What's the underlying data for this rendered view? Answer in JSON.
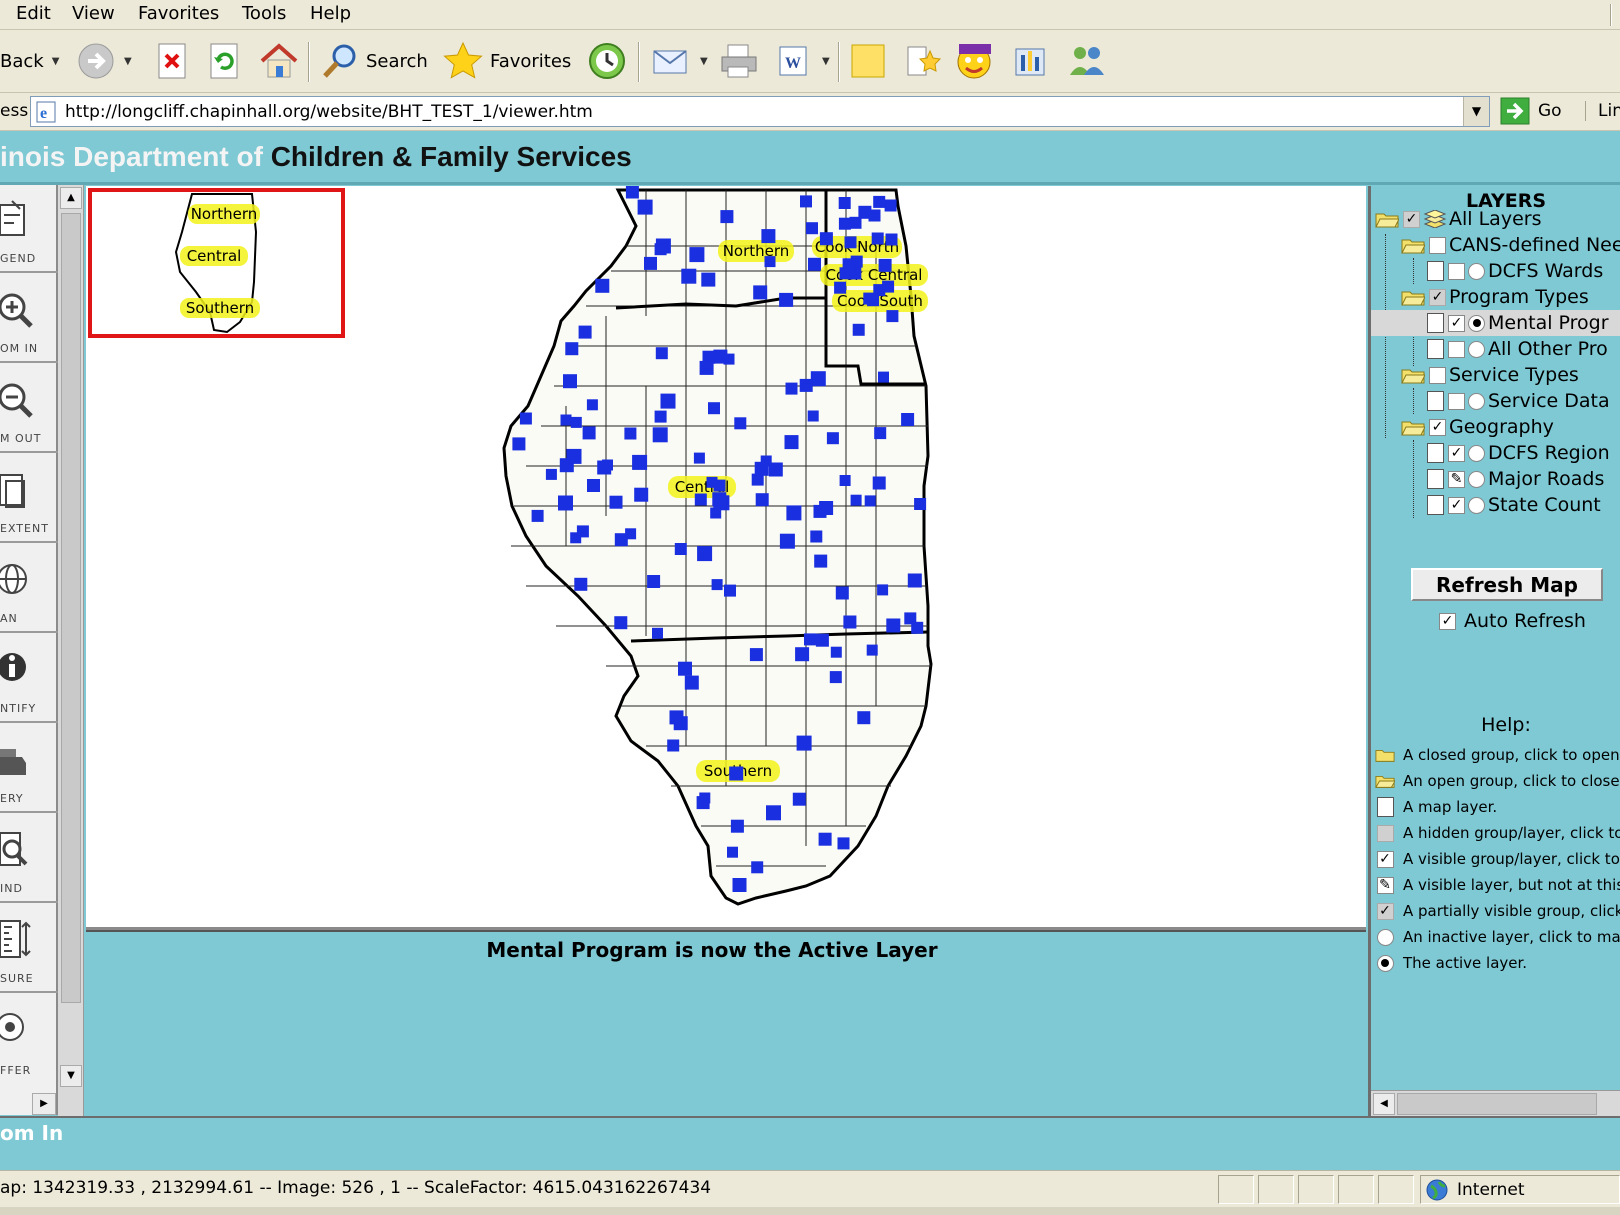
{
  "menu": [
    "Edit",
    "View",
    "Favorites",
    "Tools",
    "Help"
  ],
  "toolbar": {
    "back_label": "Back",
    "search_label": "Search",
    "favorites_label": "Favorites"
  },
  "address": {
    "label": "ess",
    "url": "http://longcliff.chapinhall.org/website/BHT_TEST_1/viewer.htm",
    "go_label": "Go",
    "links_label": "Lin"
  },
  "header": {
    "title_part1": "inois Department of",
    "title_part2": "Children & Family Services"
  },
  "tools": [
    {
      "name": "legend",
      "label": "GEND"
    },
    {
      "name": "zoom-in",
      "label": "OM IN"
    },
    {
      "name": "zoom-out",
      "label": "M OUT"
    },
    {
      "name": "full-extent",
      "label": "EXTENT"
    },
    {
      "name": "pan",
      "label": "AN"
    },
    {
      "name": "identify",
      "label": "NTIFY"
    },
    {
      "name": "query",
      "label": "ERY"
    },
    {
      "name": "find",
      "label": "IND"
    },
    {
      "name": "measure",
      "label": "SURE"
    },
    {
      "name": "buffer",
      "label": "FFER"
    }
  ],
  "overview": {
    "labels": [
      "Northern",
      "Central",
      "Southern"
    ]
  },
  "map": {
    "region_labels": [
      "Northern",
      "Cook North",
      "Cook Central",
      "Cook South",
      "Central",
      "Southern"
    ],
    "marker_color": "#1a2fe0",
    "label_highlight": "#f2f21a",
    "program_site_count": 130
  },
  "message": "Mental Program is now the Active Layer",
  "layers": {
    "title": "LAYERS",
    "items": [
      {
        "label": "All Layers",
        "kind": "group",
        "state": "partial"
      },
      {
        "label": "CANS-defined Nee",
        "kind": "group",
        "state": "hidden"
      },
      {
        "label": "DCFS Wards",
        "kind": "layer",
        "state": "hidden",
        "active": false
      },
      {
        "label": "Program Types",
        "kind": "group",
        "state": "partial"
      },
      {
        "label": "Mental Progr",
        "kind": "layer",
        "state": "visible",
        "active": true
      },
      {
        "label": "All Other Pro",
        "kind": "layer",
        "state": "hidden",
        "active": false
      },
      {
        "label": "Service Types",
        "kind": "group",
        "state": "hidden"
      },
      {
        "label": "Service Data",
        "kind": "layer",
        "state": "hidden",
        "active": false
      },
      {
        "label": "Geography",
        "kind": "group",
        "state": "visible"
      },
      {
        "label": "DCFS Region",
        "kind": "layer",
        "state": "visible",
        "active": false
      },
      {
        "label": "Major Roads",
        "kind": "layer",
        "state": "scale-hidden",
        "active": false
      },
      {
        "label": "State Count",
        "kind": "layer",
        "state": "visible",
        "active": false
      }
    ],
    "refresh_label": "Refresh Map",
    "auto_refresh_label": "Auto Refresh",
    "auto_refresh_checked": true
  },
  "help": {
    "title": "Help:",
    "items": [
      "A closed group, click to open.",
      "An open group, click to close.",
      "A map layer.",
      "A hidden group/layer, click to m",
      "A visible group/layer, click to hi",
      "A visible layer, but not at this s",
      "A partially visible group, click to",
      "An inactive layer, click to make",
      "The active layer."
    ]
  },
  "status": {
    "zoom_mode": "om In",
    "coords": "ap: 1342319.33 , 2132994.61 -- Image: 526 , 1 -- ScaleFactor: 4615.043162267434",
    "zone": "Internet"
  }
}
